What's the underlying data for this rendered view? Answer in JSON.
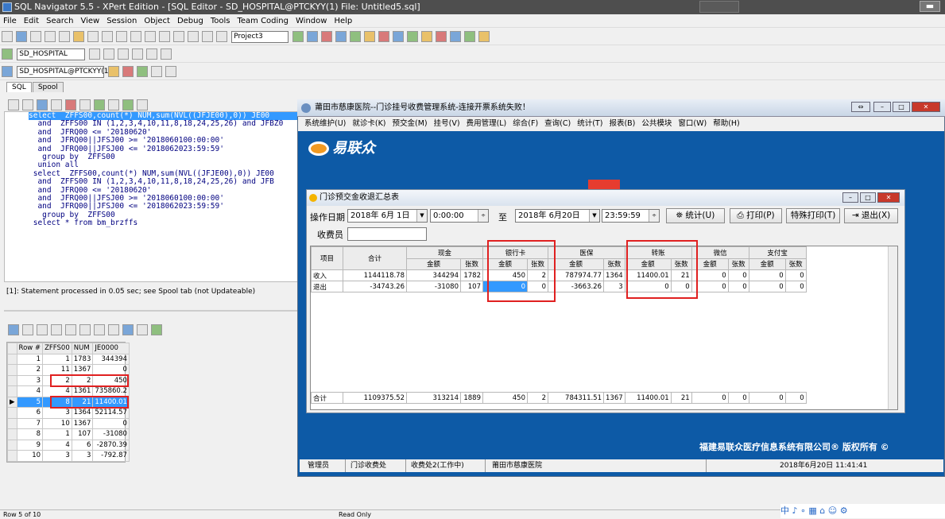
{
  "window": {
    "title": "SQL Navigator 5.5 - XPert Edition - [SQL Editor - SD_HOSPITAL@PTCKYY(1) File: Untitled5.sql]"
  },
  "menu": [
    "File",
    "Edit",
    "Search",
    "View",
    "Session",
    "Object",
    "Debug",
    "Tools",
    "Team Coding",
    "Window",
    "Help"
  ],
  "toolbar": {
    "project": "Project3",
    "connection": "SD_HOSPITAL",
    "session": "SD_HOSPITAL@PTCKYY(1"
  },
  "tabs": [
    "SQL",
    "Spool"
  ],
  "editor_lines": [
    "select  ZFFS00,count(*) NUM,sum(NVL((JFJE00),0)) JE00",
    "  and  ZFFS00 IN (1,2,3,4,10,11,8,18,24,25,26) and JFBZ0",
    "  and  JFRQ00 <= '20180620'",
    "  and  JFRQ00||JFSJ00 >= '2018060100:00:00'",
    "  and  JFRQ00||JFSJ00 <= '2018062023:59:59'",
    "   group by  ZFFS00",
    "  union all",
    " select  ZFFS00,count(*) NUM,sum(NVL((JFJE00),0)) JE00",
    "  and  ZFFS00 IN (1,2,3,4,10,11,8,18,24,25,26) and JFB",
    "  and  JFRQ00 <= '20180620'",
    "  and  JFRQ00||JFSJ00 >= '2018060100:00:00'",
    "  and  JFRQ00||JFSJ00 <= '2018062023:59:59'",
    "   group by  ZFFS00",
    "",
    "",
    " select * from bm_brzffs"
  ],
  "status_message": "[1]: Statement processed in 0.05 sec; see Spool tab (not Updateable)",
  "result_grid": {
    "headers": [
      "Row #",
      "ZFFS00",
      "NUM",
      "JE0000"
    ],
    "rows": [
      [
        "1",
        "1",
        "1783",
        "344394"
      ],
      [
        "2",
        "11",
        "1367",
        "0"
      ],
      [
        "3",
        "2",
        "2",
        "450"
      ],
      [
        "4",
        "4",
        "1361",
        "735860.2"
      ],
      [
        "5",
        "8",
        "21",
        "11400.01"
      ],
      [
        "6",
        "3",
        "1364",
        "52114.57"
      ],
      [
        "7",
        "10",
        "1367",
        "0"
      ],
      [
        "8",
        "1",
        "107",
        "-31080"
      ],
      [
        "9",
        "4",
        "6",
        "-2870.39"
      ],
      [
        "10",
        "3",
        "3",
        "-792.87"
      ]
    ]
  },
  "statusbar": {
    "row_info": "Row 5 of 10",
    "mode": "Read Only"
  },
  "app": {
    "title": "莆田市慈康医院--门诊挂号收费管理系统-连接开票系统失败！",
    "menu": [
      "系统维护(U)",
      "就诊卡(K)",
      "预交金(M)",
      "挂号(V)",
      "费用管理(L)",
      "综合(F)",
      "查询(C)",
      "统计(T)",
      "报表(B)",
      "公共模块",
      "窗口(W)",
      "帮助(H)"
    ],
    "logo_text": "易联众",
    "copyright": "福建易联众医疗信息系统有限公司® 版权所有 ©",
    "status": [
      "管理员",
      "门诊收费处",
      "收费处2(工作中)",
      "莆田市慈康医院",
      "2018年6月20日 11:41:41"
    ]
  },
  "dialog": {
    "title": "门诊预交金收退汇总表",
    "op_date_label": "操作日期",
    "start_date": "2018年 6月 1日",
    "start_time": "0:00:00",
    "to_label": "至",
    "end_date": "2018年 6月20日",
    "end_time": "23:59:59",
    "btn_stats": "统计(U)",
    "btn_print": "打印(P)",
    "btn_special_print": "特殊打印(T)",
    "btn_exit": "退出(X)",
    "cashier_label": "收费员",
    "grid": {
      "col_item": "项目",
      "col_total": "合计",
      "groups": [
        "现金",
        "银行卡",
        "医保",
        "转账",
        "微信",
        "支付宝"
      ],
      "sub_amount": "金额",
      "sub_count": "张数",
      "rows": [
        [
          "收入",
          "1144118.78",
          "344294",
          "1782",
          "450",
          "2",
          "787974.77",
          "1364",
          "11400.01",
          "21",
          "0",
          "0",
          "0",
          "0"
        ],
        [
          "退出",
          "-34743.26",
          "-31080",
          "107",
          "0",
          "0",
          "-3663.26",
          "3",
          "0",
          "0",
          "0",
          "0",
          "0",
          "0"
        ]
      ],
      "total_row": [
        "合计",
        "1109375.52",
        "313214",
        "1889",
        "450",
        "2",
        "784311.51",
        "1367",
        "11400.01",
        "21",
        "0",
        "0",
        "0",
        "0"
      ]
    }
  },
  "tray": "中 ♪ ∘ ▦ ⌂ ☺ ⚙",
  "colors": {
    "highlight": "#3399ff",
    "redbox": "#e02020",
    "app_bg": "#0d5aa6"
  }
}
